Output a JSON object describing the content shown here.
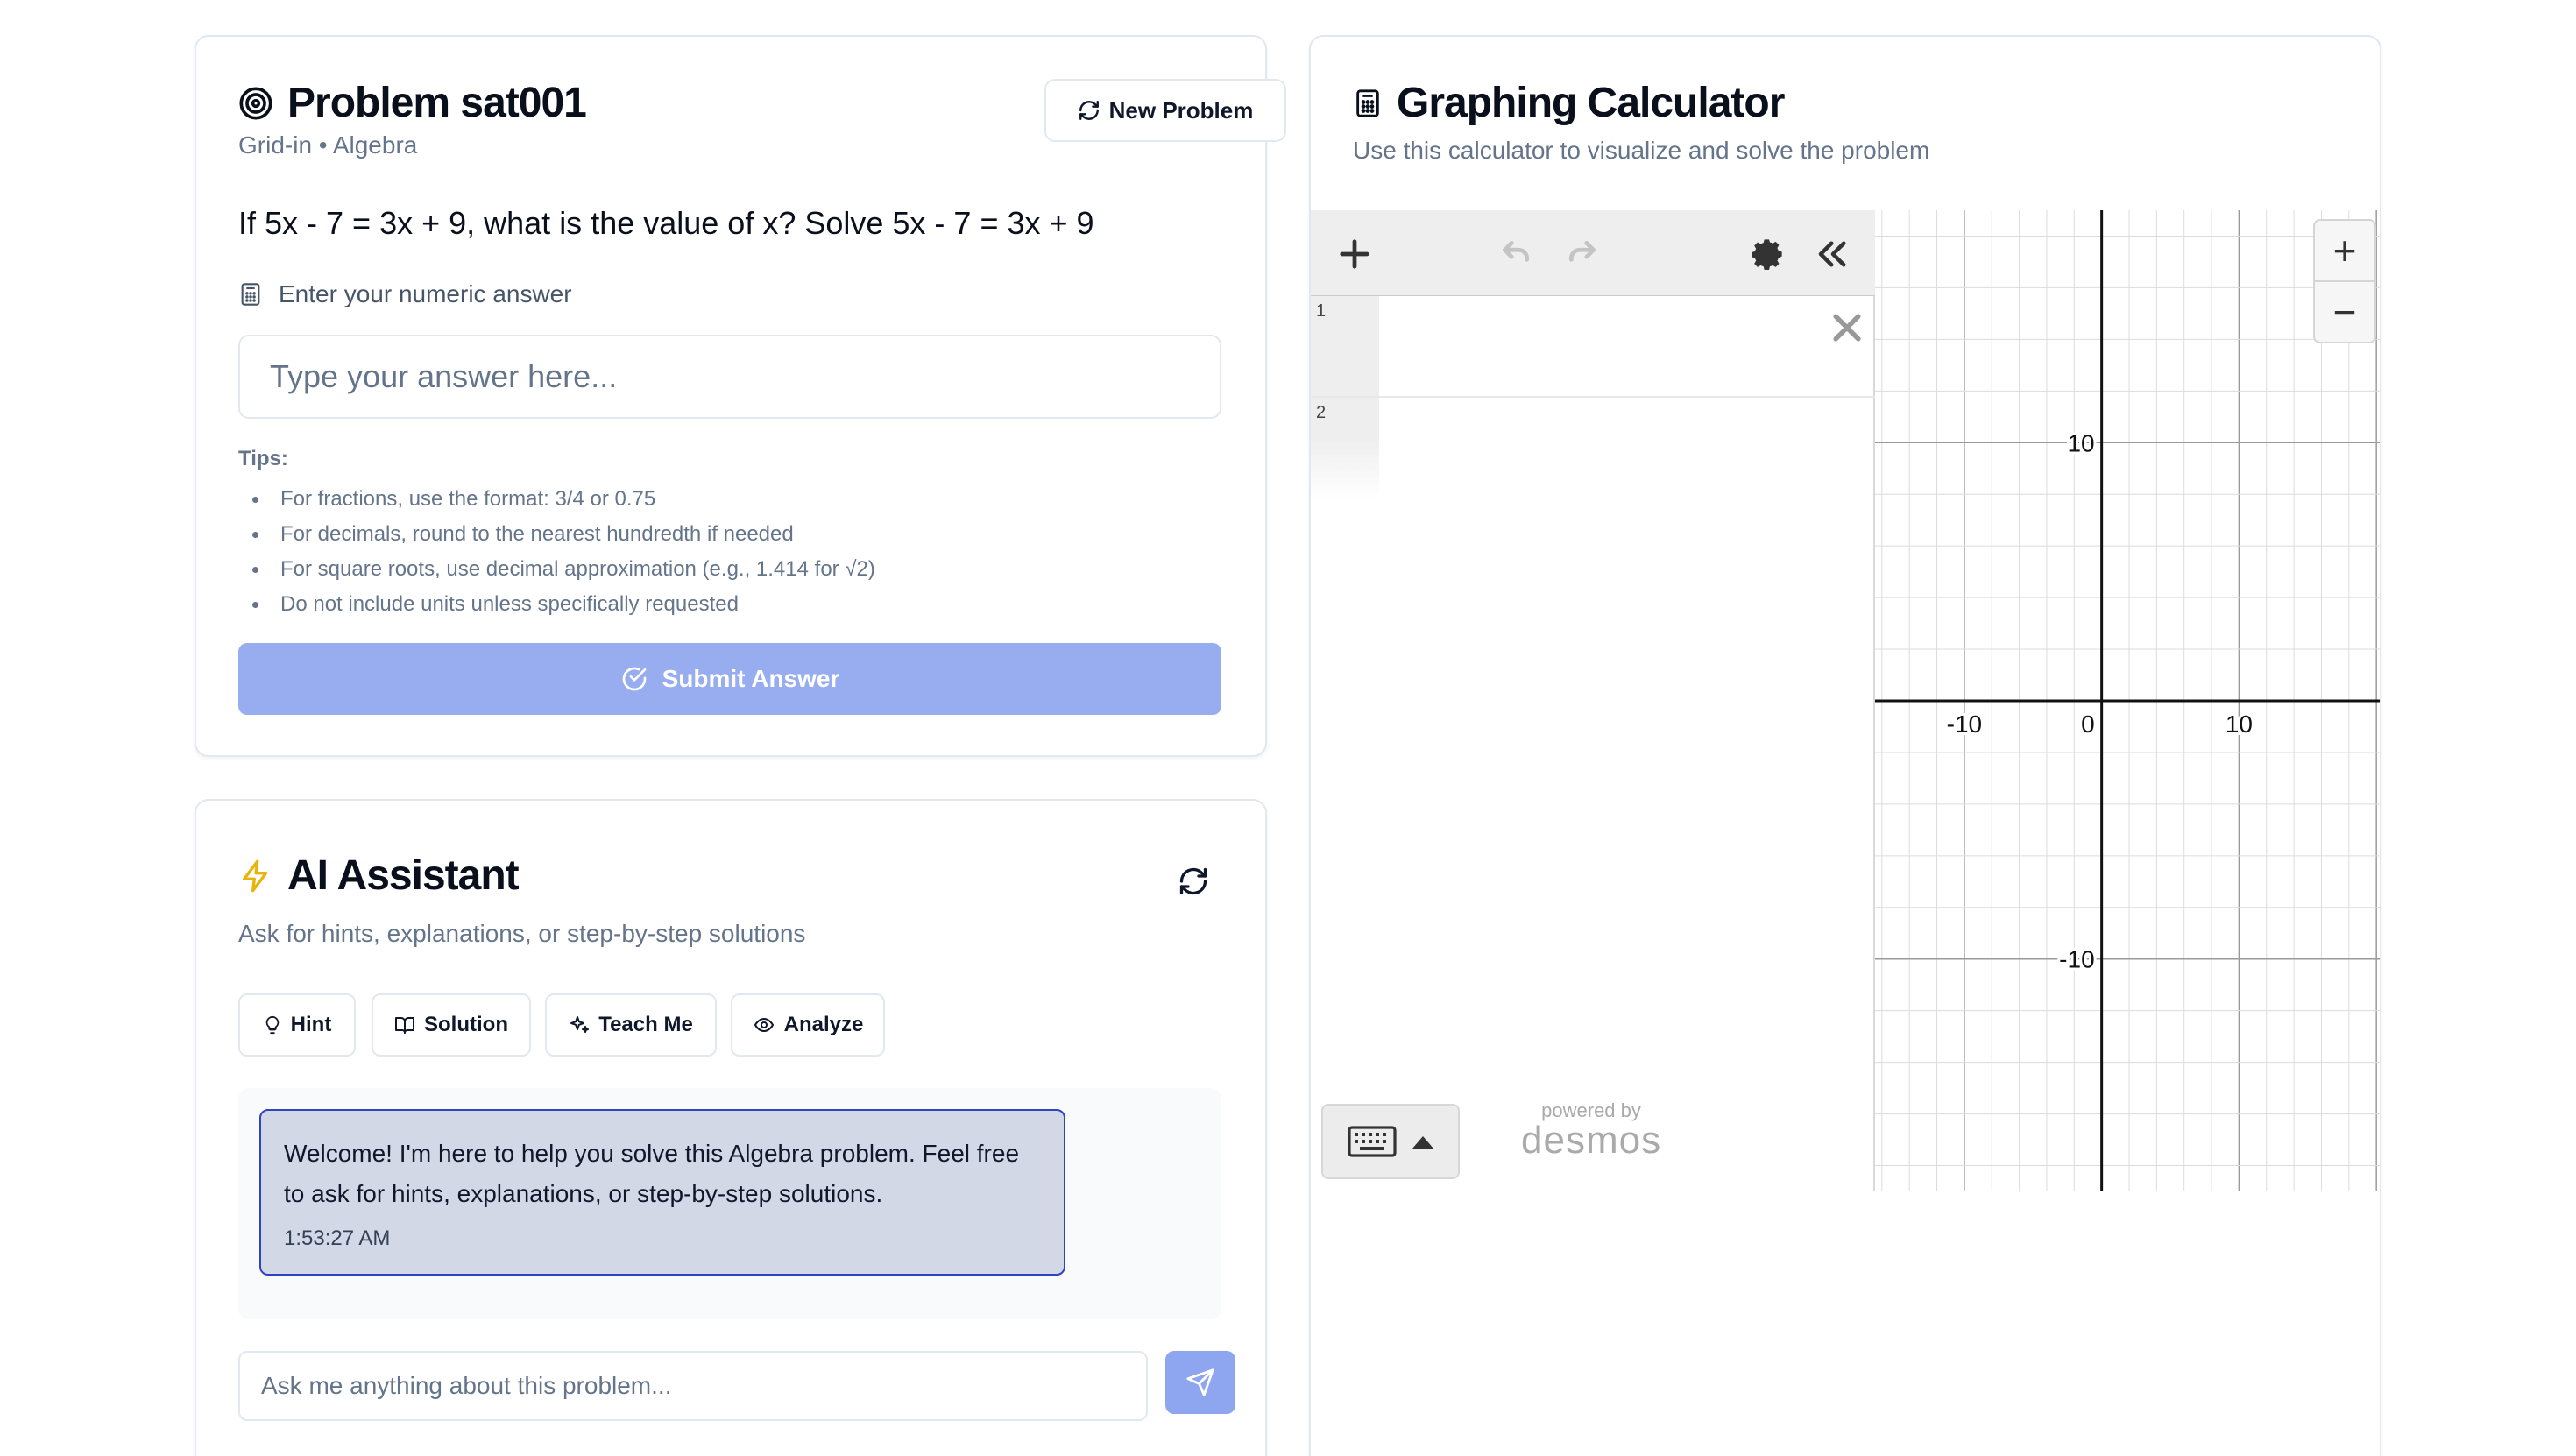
{
  "problem": {
    "title": "Problem sat001",
    "meta": "Grid-in • Algebra",
    "new_problem_label": "New Problem",
    "question": "If 5x - 7 = 3x + 9, what is the value of x? Solve 5x - 7 = 3x + 9",
    "answer_label": "Enter your numeric answer",
    "answer_placeholder": "Type your answer here...",
    "answer_value": "",
    "tips_title": "Tips:",
    "tips": [
      "For fractions, use the format: 3/4 or 0.75",
      "For decimals, round to the nearest hundredth if needed",
      "For square roots, use decimal approximation (e.g., 1.414 for √2)",
      "Do not include units unless specifically requested"
    ],
    "submit_label": "Submit Answer",
    "submit_color": "#98adf0"
  },
  "assistant": {
    "title": "AI Assistant",
    "subtitle": "Ask for hints, explanations, or step-by-step solutions",
    "chips": [
      {
        "label": "Hint",
        "icon": "lightbulb-icon"
      },
      {
        "label": "Solution",
        "icon": "book-icon"
      },
      {
        "label": "Teach Me",
        "icon": "sparkles-icon"
      },
      {
        "label": "Analyze",
        "icon": "eye-icon"
      }
    ],
    "messages": [
      {
        "text": "Welcome! I'm here to help you solve this Algebra problem. Feel free to ask for hints, explanations, or step-by-step solutions.",
        "time": "1:53:27 AM"
      }
    ],
    "input_placeholder": "Ask me anything about this problem...",
    "accent_color": "#eab308"
  },
  "calculator": {
    "title": "Graphing Calculator",
    "subtitle": "Use this calculator to visualize and solve the problem",
    "expression_rows": [
      "1",
      "2"
    ],
    "powered_by": "powered by",
    "brand": "desmos",
    "graph": {
      "x_range": [
        -16.5,
        20.5
      ],
      "y_range": [
        -19,
        19
      ],
      "grid_step": 2,
      "tick_labels_x": [
        "-10",
        "0",
        "10"
      ],
      "tick_labels_y": [
        "10",
        "-10"
      ]
    }
  }
}
